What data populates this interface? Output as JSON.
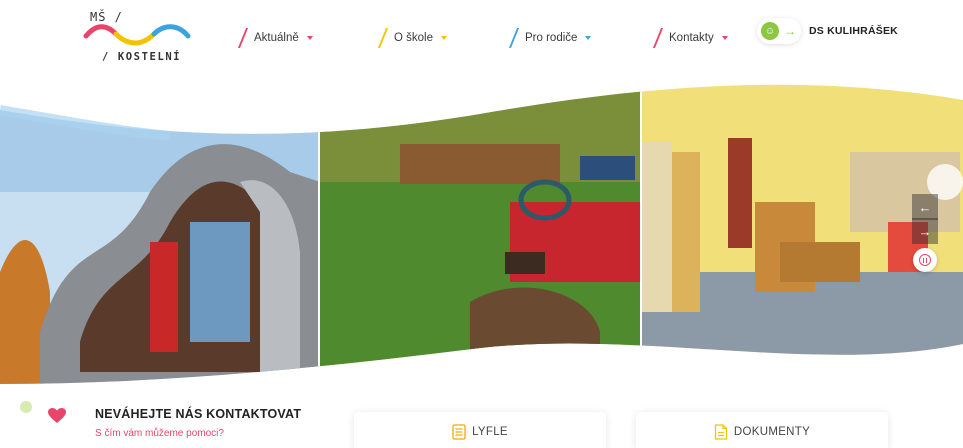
{
  "logo": {
    "top_text": "MŠ /",
    "bottom_text": "/ KOSTELNÍ"
  },
  "nav": {
    "items": [
      {
        "label": "Aktuálně",
        "accent": "#e8456b"
      },
      {
        "label": "O škole",
        "accent": "#f2c300"
      },
      {
        "label": "Pro rodiče",
        "accent": "#3ea3dc"
      },
      {
        "label": "Kontakty",
        "accent": "#e8456b"
      }
    ]
  },
  "ds": {
    "label": "DS KULIHRÁŠEK",
    "accent": "#8dc63f",
    "icon": "smiley-icon",
    "arrow": "→"
  },
  "slider": {
    "prev": "←",
    "next": "→",
    "pause_icon": "pause-icon"
  },
  "contact": {
    "title": "NEVÁHEJTE NÁS KONTAKTOVAT",
    "subtitle": "S čím vám můžeme pomoci?",
    "icon": "heart-icon",
    "accent": "#e8456b"
  },
  "cards": [
    {
      "label": "LYFLE",
      "icon": "leaflet-icon"
    },
    {
      "label": "DOKUMENTY",
      "icon": "document-icon"
    }
  ]
}
